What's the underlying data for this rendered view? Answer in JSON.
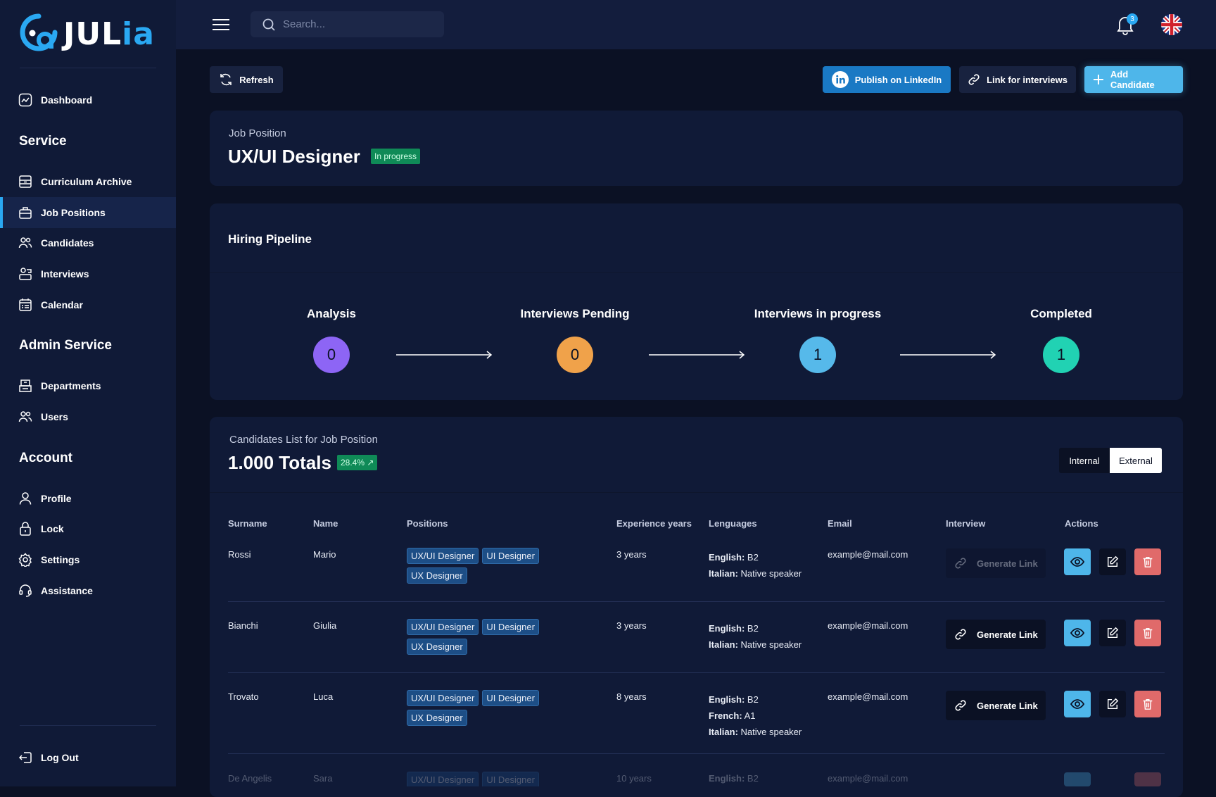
{
  "brand": {
    "logo_text_main": "JUL",
    "logo_text_accent": "ia",
    "accent": "#2aa8f2"
  },
  "sidebar": {
    "dashboard": "Dashboard",
    "service_title": "Service",
    "service_items": [
      "Curriculum Archive",
      "Job Positions",
      "Candidates",
      "Interviews",
      "Calendar"
    ],
    "admin_title": "Admin Service",
    "admin_items": [
      "Departments",
      "Users"
    ],
    "account_title": "Account",
    "account_items": [
      "Profile",
      "Lock",
      "Settings",
      "Assistance"
    ],
    "logout": "Log Out"
  },
  "topbar": {
    "search_placeholder": "Search...",
    "notifications": "3",
    "language_icon": "uk-flag-icon"
  },
  "toolbar": {
    "refresh": "Refresh",
    "publish": "Publish on LinkedIn",
    "link": "Link for interviews",
    "add": "Add Candidate"
  },
  "job": {
    "label": "Job Position",
    "title": "UX/UI Designer",
    "status": "In progress"
  },
  "pipeline": {
    "title": "Hiring Pipeline",
    "stages": [
      {
        "name": "Analysis",
        "count": "0",
        "color": "#8d65f5"
      },
      {
        "name": "Interviews Pending",
        "count": "0",
        "color": "#f0a24a"
      },
      {
        "name": "Interviews in progress",
        "count": "1",
        "color": "#56b9ea"
      },
      {
        "name": "Completed",
        "count": "1",
        "color": "#21d2b3"
      }
    ]
  },
  "candidates": {
    "label": "Candidates List for Job Position",
    "total": "1.000 Totals",
    "growth": "28.4% ↗",
    "toggle": [
      "Internal",
      "External"
    ],
    "columns": [
      "Surname",
      "Name",
      "Positions",
      "Experience years",
      "Lenguages",
      "Email",
      "Interview",
      "Actions"
    ],
    "generate_label": "Generate Link",
    "rows": [
      {
        "surname": "Rossi",
        "name": "Mario",
        "tags": [
          "UX/UI Designer",
          "UI Designer",
          "UX Designer"
        ],
        "exp": "3 years",
        "langs": [
          [
            "English:",
            "B2"
          ],
          [
            "Italian:",
            "Native speaker"
          ]
        ],
        "email": "example@mail.com"
      },
      {
        "surname": "Bianchi",
        "name": "Giulia",
        "tags": [
          "UX/UI Designer",
          "UI Designer",
          "UX Designer"
        ],
        "exp": "3 years",
        "langs": [
          [
            "English:",
            "B2"
          ],
          [
            "Italian:",
            "Native speaker"
          ]
        ],
        "email": "example@mail.com"
      },
      {
        "surname": "Trovato",
        "name": "Luca",
        "tags": [
          "UX/UI Designer",
          "UI Designer",
          "UX Designer"
        ],
        "exp": "8 years",
        "langs": [
          [
            "English:",
            "B2"
          ],
          [
            "French:",
            "A1"
          ],
          [
            "Italian:",
            "Native speaker"
          ]
        ],
        "email": "example@mail.com"
      },
      {
        "surname": "De Angelis",
        "name": "Sara",
        "tags": [
          "UX/UI Designer",
          "UI Designer"
        ],
        "exp": "10 years",
        "langs": [
          [
            "English:",
            "B2"
          ]
        ],
        "email": "example@mail.com"
      }
    ]
  }
}
